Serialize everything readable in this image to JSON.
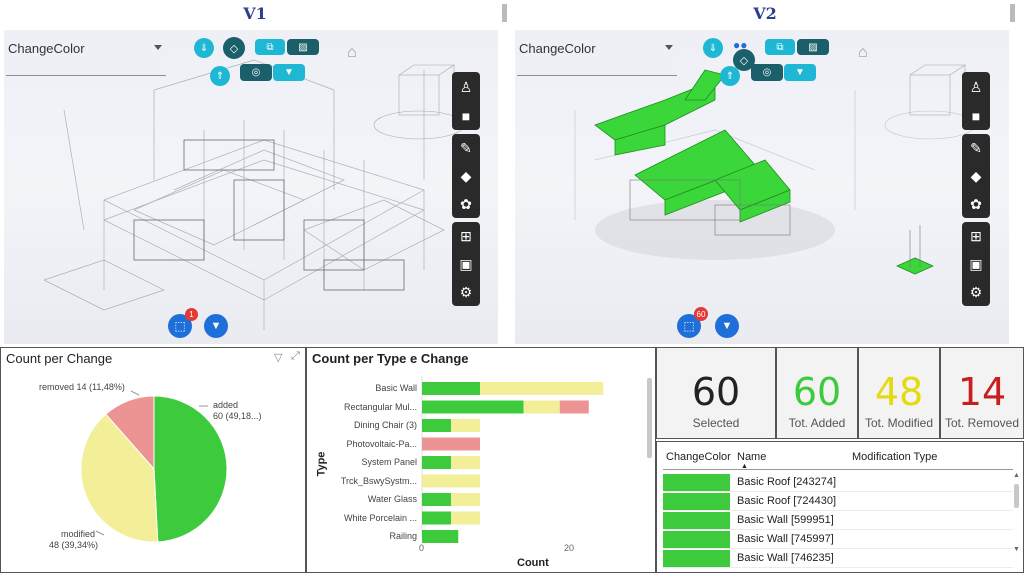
{
  "header": {
    "left_version": "V1",
    "right_version": "V2"
  },
  "viewers": [
    {
      "dropdown_value": "ChangeColor",
      "selection_badge": "1"
    },
    {
      "dropdown_value": "ChangeColor",
      "selection_badge": "60"
    }
  ],
  "colors": {
    "added": "#3dcb3d",
    "modified": "#f3ef98",
    "removed": "#ec9393",
    "accent": "#1fb8d4"
  },
  "pie_panel": {
    "title": "Count per Change",
    "labels": {
      "removed": "removed 14 (11,48%)",
      "added_1": "added",
      "added_2": "60 (49,18...)",
      "modified_1": "modified",
      "modified_2": "48 (39,34%)"
    }
  },
  "bar_panel": {
    "title": "Count per Type e Change",
    "ylabel": "Type",
    "xlabel": "Count",
    "ticks": [
      "0",
      "20"
    ]
  },
  "kpis": [
    {
      "value": "60",
      "label": "Selected",
      "color": "#222222"
    },
    {
      "value": "60",
      "label": "Tot. Added",
      "color": "#3dcb3d"
    },
    {
      "value": "48",
      "label": "Tot. Modified",
      "color": "#e6d90e"
    },
    {
      "value": "14",
      "label": "Tot. Removed",
      "color": "#c81e1e"
    }
  ],
  "table": {
    "headers": [
      "ChangeColor",
      "Name",
      "Modification Type"
    ],
    "rows": [
      {
        "name": "Basic Roof [243274]"
      },
      {
        "name": "Basic Roof [724430]"
      },
      {
        "name": "Basic Wall [599951]"
      },
      {
        "name": "Basic Wall [745997]"
      },
      {
        "name": "Basic Wall [746235]"
      }
    ]
  },
  "chart_data": [
    {
      "type": "pie",
      "title": "Count per Change",
      "slices": [
        {
          "label": "added",
          "value": 60,
          "percent": 49.18
        },
        {
          "label": "modified",
          "value": 48,
          "percent": 39.34
        },
        {
          "label": "removed",
          "value": 14,
          "percent": 11.48
        }
      ]
    },
    {
      "type": "bar",
      "orientation": "horizontal",
      "stacked": true,
      "title": "Count per Type e Change",
      "xlabel": "Count",
      "ylabel": "Type",
      "xlim": [
        0,
        25
      ],
      "categories": [
        "Basic Wall",
        "Rectangular Mul...",
        "Dining Chair (3)",
        "Photovoltaic-Pa...",
        "System Panel",
        "Trck_BswySystm...",
        "Water Glass",
        "White Porcelain ...",
        "Railing"
      ],
      "series": [
        {
          "name": "added",
          "values": [
            8,
            14,
            4,
            0,
            4,
            0,
            4,
            4,
            5
          ]
        },
        {
          "name": "modified",
          "values": [
            17,
            5,
            4,
            0,
            4,
            8,
            4,
            4,
            0
          ]
        },
        {
          "name": "removed",
          "values": [
            0,
            4,
            0,
            8,
            0,
            0,
            0,
            0,
            0
          ]
        }
      ]
    }
  ]
}
